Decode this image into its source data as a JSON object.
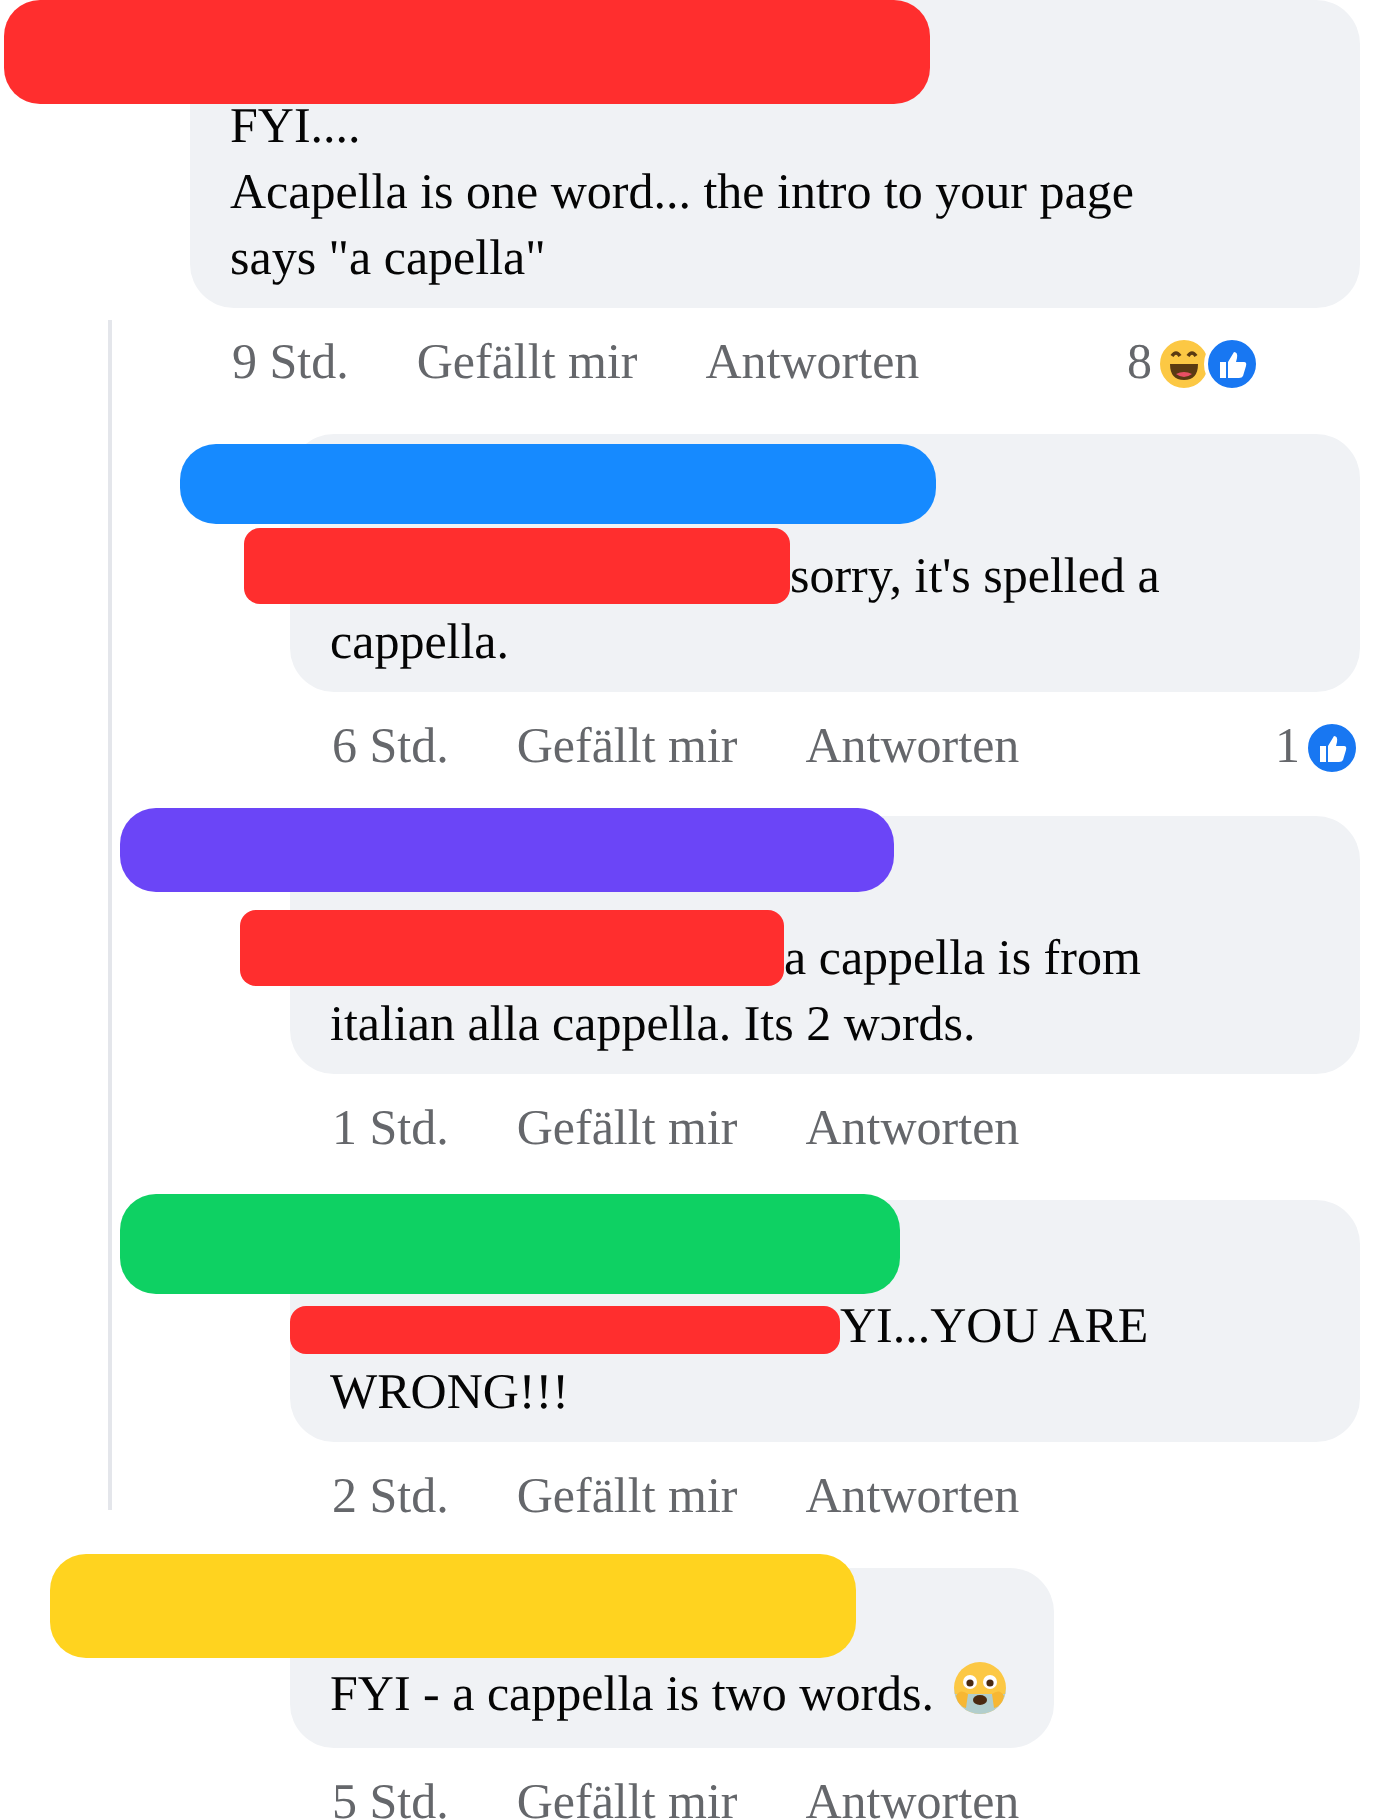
{
  "comments": [
    {
      "name_redaction": {
        "color": "#ff2e2e"
      },
      "text": "FYI....\nAcapella is one word... the intro to your page says \"a capella\"",
      "time": "9 Std.",
      "like": "Gefällt mir",
      "reply": "Antworten",
      "reactions": {
        "count": "8",
        "icons": [
          {
            "kind": "haha"
          },
          {
            "kind": "like"
          }
        ]
      }
    },
    {
      "name_redaction": {
        "color": "#168aff"
      },
      "text_redaction": {
        "color": "#ff2e2e"
      },
      "text": "sorry, it's spelled a cappella.",
      "time": "6 Std.",
      "like": "Gefällt mir",
      "reply": "Antworten",
      "reactions": {
        "count": "1",
        "icons": [
          {
            "kind": "like"
          }
        ]
      }
    },
    {
      "name_redaction": {
        "color": "#6b45f7"
      },
      "text_redaction": {
        "color": "#ff2e2e"
      },
      "text": "a cappella is from italian alla cappella. Its 2 wɔrds.",
      "time": "1 Std.",
      "like": "Gefällt mir",
      "reply": "Antworten"
    },
    {
      "name_redaction": {
        "color": "#0ed163"
      },
      "text_redaction": {
        "color": "#ff2e2e"
      },
      "text": "YI...YOU ARE WRONG!!!",
      "time": "2 Std.",
      "like": "Gefällt mir",
      "reply": "Antworten"
    },
    {
      "name_redaction": {
        "color": "#ffd31f"
      },
      "text": "FYI - a cappella is two words.",
      "emoji": {
        "kind": "anxious"
      },
      "time": "5 Std.",
      "like": "Gefällt mir",
      "reply": "Antworten"
    }
  ]
}
